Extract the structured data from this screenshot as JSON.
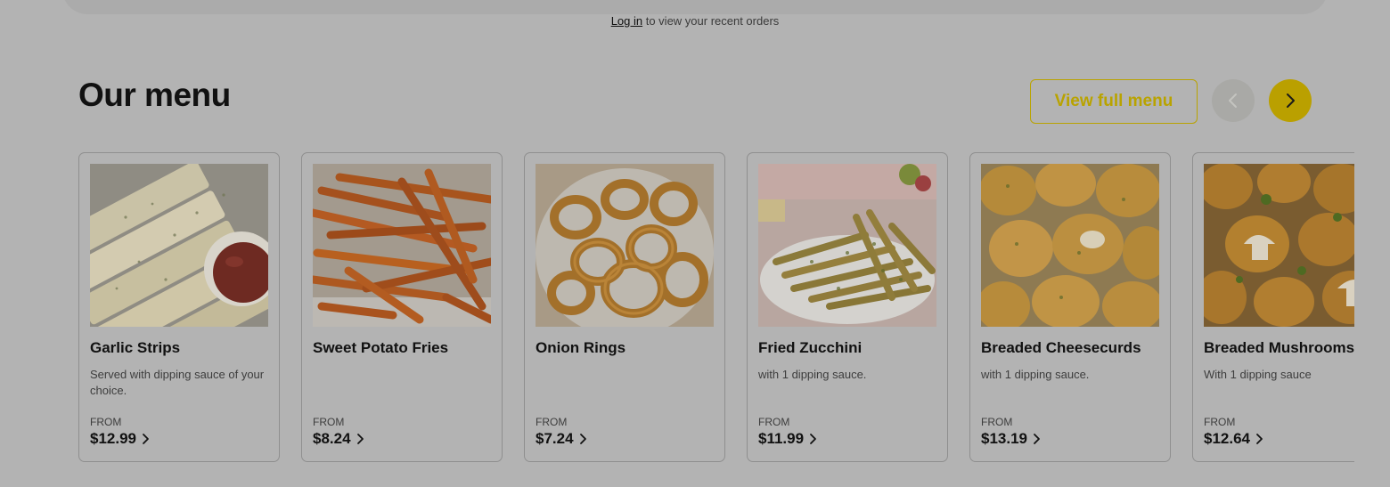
{
  "login_prompt": {
    "link": "Log in",
    "text": " to view your recent orders"
  },
  "menu": {
    "title": "Our menu",
    "view_full_label": "View full menu",
    "prev_icon": "chevron-left-icon",
    "next_icon": "chevron-right-icon"
  },
  "items": [
    {
      "name": "Garlic Strips",
      "description": "Served with dipping sauce of your choice.",
      "from": "FROM",
      "price": "$12.99",
      "image": "garlic-strips-photo"
    },
    {
      "name": "Sweet Potato Fries",
      "description": "",
      "from": "FROM",
      "price": "$8.24",
      "image": "sweet-potato-fries-photo"
    },
    {
      "name": "Onion Rings",
      "description": "",
      "from": "FROM",
      "price": "$7.24",
      "image": "onion-rings-photo"
    },
    {
      "name": "Fried Zucchini",
      "description": "with 1 dipping sauce.",
      "from": "FROM",
      "price": "$11.99",
      "image": "fried-zucchini-photo"
    },
    {
      "name": "Breaded Cheesecurds",
      "description": "with 1 dipping sauce.",
      "from": "FROM",
      "price": "$13.19",
      "image": "breaded-cheesecurds-photo"
    },
    {
      "name": "Breaded Mushrooms",
      "description": "With 1 dipping sauce",
      "from": "FROM",
      "price": "$12.64",
      "image": "breaded-mushrooms-photo"
    }
  ],
  "colors": {
    "background": "#b3b3b3",
    "accent": "#baa000",
    "text": "#111111"
  }
}
